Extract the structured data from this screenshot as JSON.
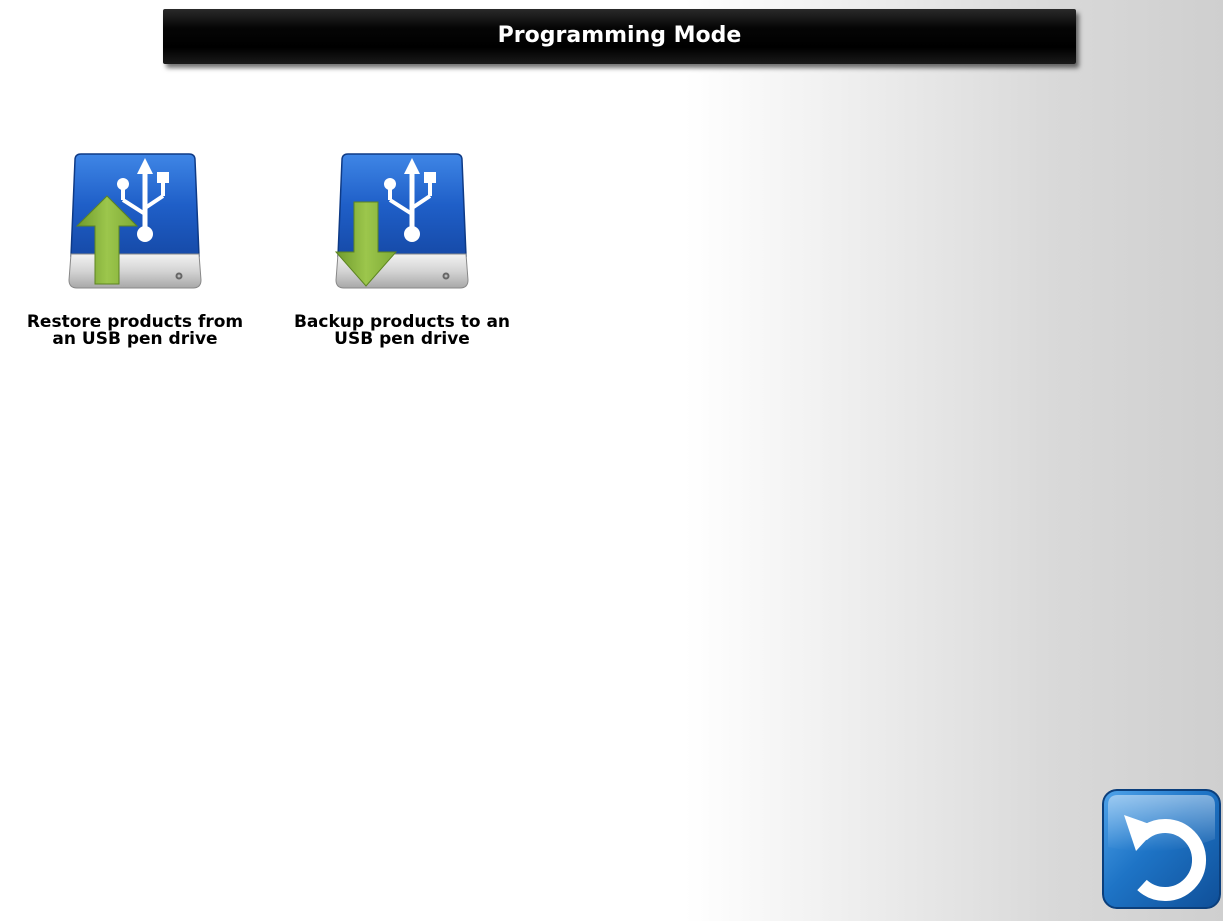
{
  "header": {
    "title": "Programming Mode"
  },
  "tiles": [
    {
      "label_line1": "Restore products from",
      "label_line2": "an USB pen drive",
      "icon": "usb-drive-upload-icon"
    },
    {
      "label_line1": "Backup products to an",
      "label_line2": "USB pen drive",
      "icon": "usb-drive-download-icon"
    }
  ],
  "back_button": {
    "icon": "back-arrow-icon"
  },
  "colors": {
    "title_bar": "#000000",
    "title_text": "#ffffff",
    "drive_blue": "#1f5fc8",
    "arrow_green": "#8ab83e",
    "back_button_blue": "#1e74c6"
  }
}
